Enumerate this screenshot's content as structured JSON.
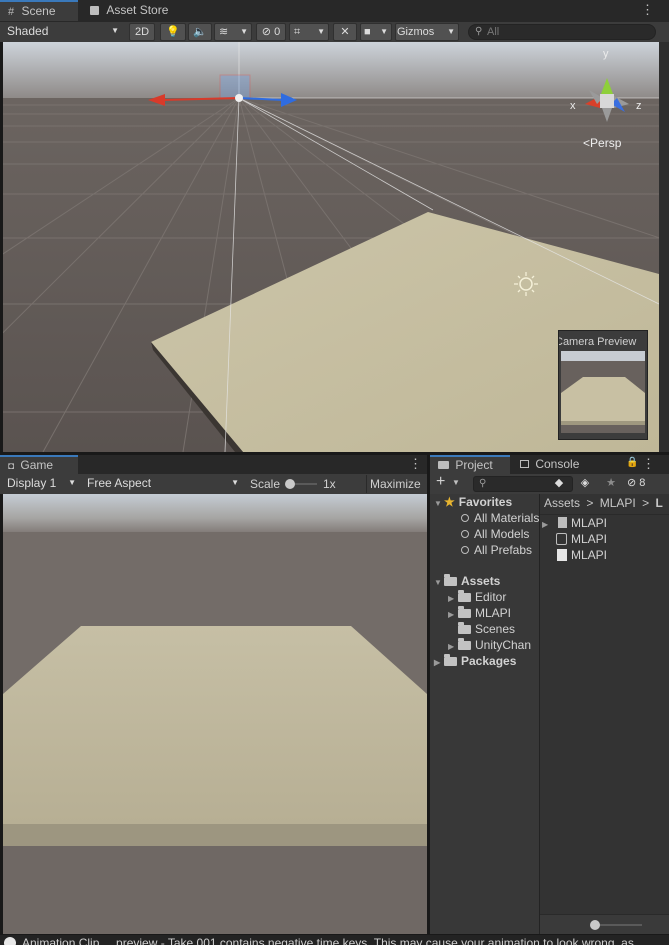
{
  "scene_tabs": {
    "scene": "Scene",
    "asset_store": "Asset Store"
  },
  "scene_toolbar": {
    "shading": "Shaded",
    "mode_2d": "2D",
    "hidden_count": "0",
    "gizmos": "Gizmos",
    "search_placeholder": "All"
  },
  "scene_view": {
    "gizmo_y": "y",
    "gizmo_x": "x",
    "gizmo_z": "z",
    "projection": "Persp",
    "camera_preview": "Camera Preview"
  },
  "game_tabs": {
    "game": "Game"
  },
  "game_toolbar": {
    "display": "Display 1",
    "aspect": "Free Aspect",
    "scale_label": "Scale",
    "scale_value": "1x",
    "maximize": "Maximize"
  },
  "project_tabs": {
    "project": "Project",
    "console": "Console"
  },
  "project_toolbar": {
    "add": "+",
    "hidden_count": "8"
  },
  "project_tree": {
    "favorites": "Favorites",
    "favorite_items": [
      "All Materials",
      "All Models",
      "All Prefabs"
    ],
    "assets": "Assets",
    "asset_folders": [
      "Editor",
      "MLAPI",
      "Scenes",
      "UnityChan"
    ],
    "packages": "Packages"
  },
  "project_content": {
    "breadcrumb": [
      "Assets",
      "MLAPI",
      "L"
    ],
    "items": [
      "MLAPI",
      "MLAPI",
      "MLAPI"
    ]
  },
  "status_bar": {
    "message": "Animation Clip ... preview - Take 001 contains negative time keys. This may cause your animation to look wrong, as"
  },
  "colors": {
    "sky": "#c9cfd6",
    "ground": "#6b6460",
    "plane": "#c8c0a3",
    "selected_tab": "#3a79bb"
  }
}
